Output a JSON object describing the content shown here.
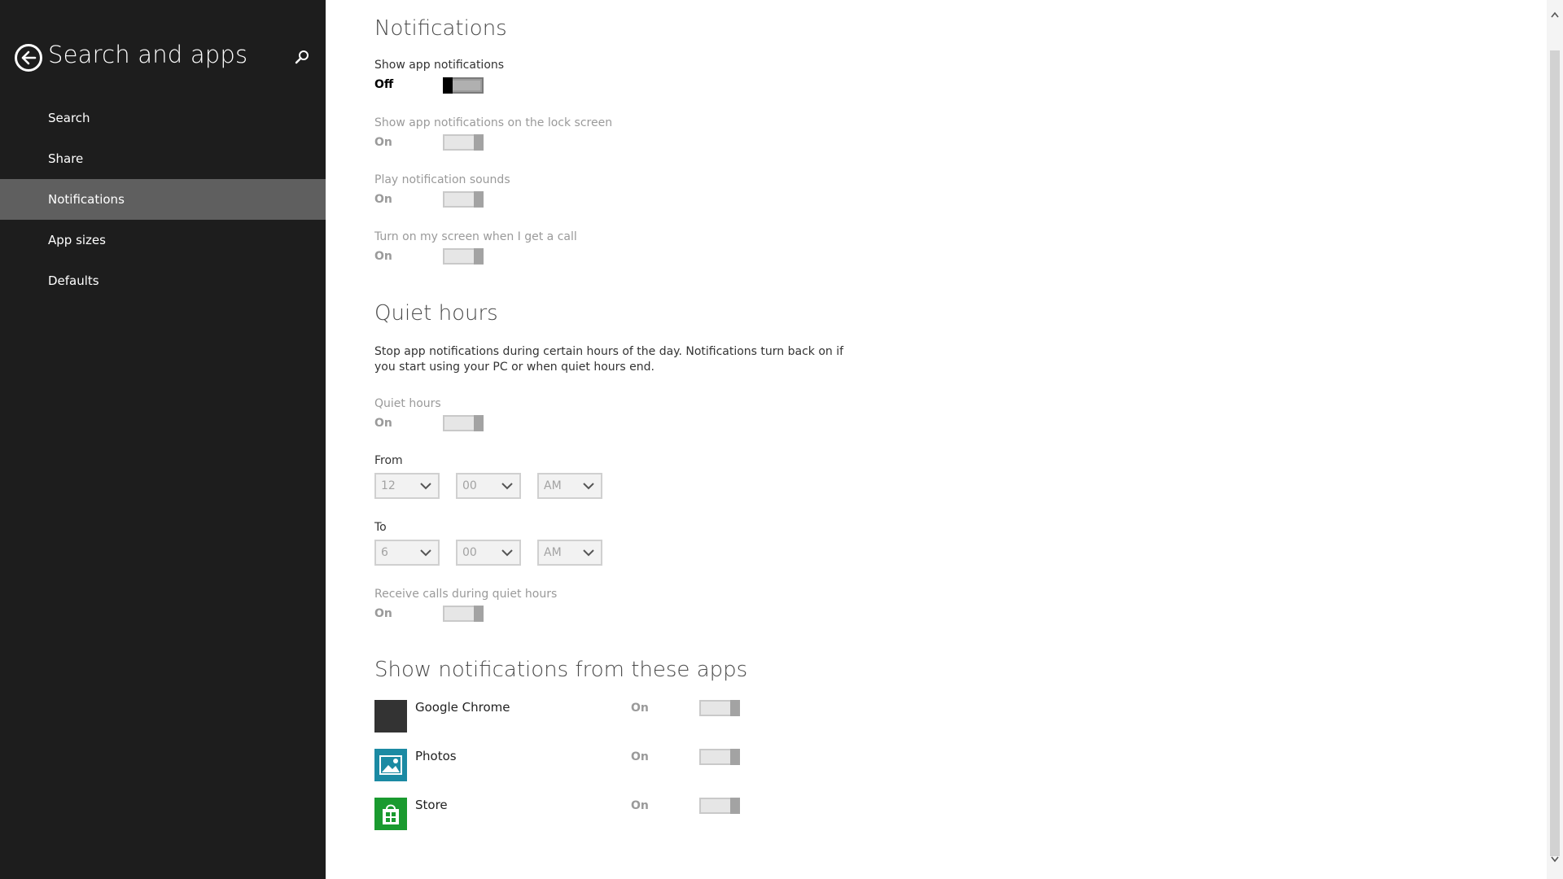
{
  "sidebar": {
    "title": "Search and apps",
    "back_icon": "back-arrow-icon",
    "search_icon": "search-icon",
    "items": [
      {
        "label": "Search"
      },
      {
        "label": "Share"
      },
      {
        "label": "Notifications",
        "selected": true
      },
      {
        "label": "App sizes"
      },
      {
        "label": "Defaults"
      }
    ]
  },
  "notifications": {
    "heading": "Notifications",
    "settings": [
      {
        "label": "Show app notifications",
        "state": "Off",
        "enabled": true
      },
      {
        "label": "Show app notifications on the lock screen",
        "state": "On",
        "enabled": false
      },
      {
        "label": "Play notification sounds",
        "state": "On",
        "enabled": false
      },
      {
        "label": "Turn on my screen when I get a call",
        "state": "On",
        "enabled": false
      }
    ]
  },
  "quiet_hours": {
    "heading": "Quiet hours",
    "description": "Stop app notifications during certain hours of the day. Notifications turn back on if you start using your PC or when quiet hours end.",
    "toggle": {
      "label": "Quiet hours",
      "state": "On"
    },
    "from_label": "From",
    "from": {
      "hour": "12",
      "minute": "00",
      "period": "AM"
    },
    "to_label": "To",
    "to": {
      "hour": "6",
      "minute": "00",
      "period": "AM"
    },
    "receive_calls": {
      "label": "Receive calls during quiet hours",
      "state": "On"
    }
  },
  "apps_section": {
    "heading": "Show notifications from these apps",
    "apps": [
      {
        "name": "Google Chrome",
        "state": "On",
        "tile_color": "#333333"
      },
      {
        "name": "Photos",
        "state": "On",
        "tile_color": "#1b8aa3"
      },
      {
        "name": "Store",
        "state": "On",
        "tile_color": "#1a9a2f"
      }
    ]
  },
  "colors": {
    "sidebar_bg": "#1d1d1d",
    "selected_bg": "#5f5f5f",
    "disabled_text": "#9a9a9a"
  }
}
